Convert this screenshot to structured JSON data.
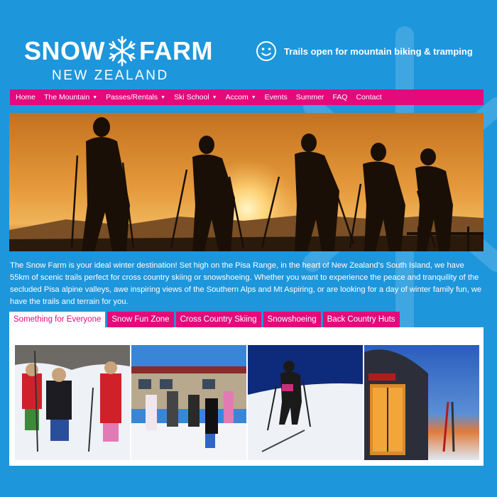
{
  "header": {
    "logo_word1": "SNOW",
    "logo_word2": "FARM",
    "logo_sub": "NEW ZEALAND",
    "status_icon": "smiley-icon",
    "status_text": "Trails open for mountain biking & tramping"
  },
  "nav": {
    "items": [
      {
        "label": "Home",
        "has_menu": false
      },
      {
        "label": "The Mountain",
        "has_menu": true
      },
      {
        "label": "Passes/Rentals",
        "has_menu": true
      },
      {
        "label": "Ski School",
        "has_menu": true
      },
      {
        "label": "Accom",
        "has_menu": true
      },
      {
        "label": "Events",
        "has_menu": false
      },
      {
        "label": "Summer",
        "has_menu": false
      },
      {
        "label": "FAQ",
        "has_menu": false
      },
      {
        "label": "Contact",
        "has_menu": false
      }
    ],
    "caret": "▼"
  },
  "intro": "The Snow Farm is your ideal winter destination!  Set high on the Pisa Range, in the heart of New Zealand’s South Island, we have 55km of scenic trails perfect for cross country skiing or snowshoeing. Whether you want to experience the peace and tranquility of the secluded Pisa alpine valleys, awe inspiring views of the Southern Alps and Mt Aspiring, or are looking for a day of winter family fun, we have the trails and terrain for you.",
  "tabs": [
    {
      "label": "Something for Everyone",
      "active": true
    },
    {
      "label": "Snow Fun Zone",
      "active": false
    },
    {
      "label": "Cross Country Skiing",
      "active": false
    },
    {
      "label": "Snowshoeing",
      "active": false
    },
    {
      "label": "Back Country Huts",
      "active": false
    }
  ],
  "colors": {
    "background": "#1e96db",
    "accent": "#e30a7c",
    "text_light": "#ffffff"
  }
}
